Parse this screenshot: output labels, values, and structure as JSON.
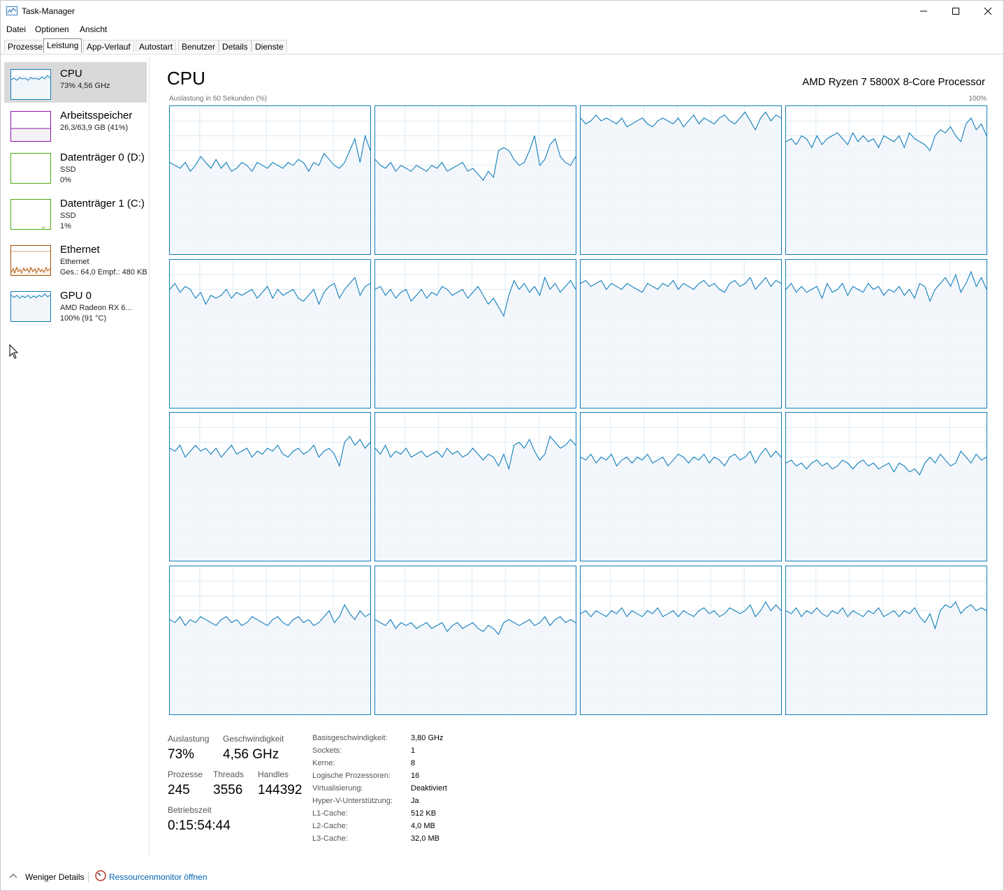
{
  "window": {
    "title": "Task-Manager"
  },
  "menu": [
    "Datei",
    "Optionen",
    "Ansicht"
  ],
  "tabs": [
    "Prozesse",
    "Leistung",
    "App-Verlauf",
    "Autostart",
    "Benutzer",
    "Details",
    "Dienste"
  ],
  "active_tab": "Leistung",
  "sidebar": {
    "items": [
      {
        "title": "CPU",
        "line1": "73% 4,56 GHz",
        "line2": "",
        "color": "#117dbb"
      },
      {
        "title": "Arbeitsspeicher",
        "line1": "26,3/63,9 GB (41%)",
        "line2": "",
        "color": "#8b12ae"
      },
      {
        "title": "Datenträger 0 (D:)",
        "line1": "SSD",
        "line2": "0%",
        "color": "#4da60c"
      },
      {
        "title": "Datenträger 1 (C:)",
        "line1": "SSD",
        "line2": "1%",
        "color": "#4da60c"
      },
      {
        "title": "Ethernet",
        "line1": "Ethernet",
        "line2": "Ges.: 64,0  Empf.: 480 KB",
        "color": "#a74f01"
      },
      {
        "title": "GPU 0",
        "line1": "AMD Radeon RX 6...",
        "line2": "100%  (91 °C)",
        "color": "#117dbb"
      }
    ]
  },
  "main": {
    "title": "CPU",
    "processor": "AMD Ryzen 7 5800X 8-Core Processor",
    "axis_label": "Auslastung in 60 Sekunden (%)",
    "axis_max": "100%"
  },
  "chart_data": {
    "type": "line",
    "description_units": "percent utilization per logical processor over 60 seconds",
    "ylim": [
      0,
      100
    ],
    "x_range_seconds": [
      60,
      0
    ],
    "grid": true,
    "series": [
      {
        "values": [
          62,
          60,
          58,
          62,
          56,
          60,
          66,
          62,
          58,
          64,
          58,
          62,
          56,
          58,
          62,
          60,
          56,
          62,
          60,
          58,
          62,
          60,
          58,
          62,
          60,
          64,
          62,
          56,
          62,
          60,
          68,
          64,
          60,
          58,
          62,
          70,
          78,
          62,
          80,
          70
        ]
      },
      {
        "values": [
          64,
          60,
          58,
          62,
          56,
          60,
          58,
          56,
          60,
          58,
          56,
          60,
          58,
          62,
          56,
          58,
          60,
          62,
          56,
          58,
          54,
          50,
          56,
          52,
          70,
          72,
          70,
          64,
          60,
          62,
          70,
          80,
          60,
          64,
          74,
          78,
          66,
          62,
          60,
          66
        ]
      },
      {
        "values": [
          92,
          88,
          90,
          94,
          90,
          92,
          90,
          88,
          92,
          86,
          88,
          90,
          92,
          88,
          86,
          90,
          92,
          90,
          88,
          92,
          86,
          90,
          94,
          88,
          92,
          90,
          88,
          92,
          94,
          90,
          88,
          92,
          96,
          90,
          84,
          92,
          96,
          90,
          94,
          92
        ]
      },
      {
        "values": [
          76,
          78,
          74,
          80,
          78,
          72,
          80,
          74,
          78,
          80,
          82,
          78,
          74,
          82,
          76,
          80,
          76,
          78,
          72,
          80,
          78,
          76,
          80,
          72,
          82,
          78,
          76,
          74,
          70,
          80,
          84,
          82,
          86,
          80,
          76,
          88,
          92,
          84,
          88,
          80
        ]
      },
      {
        "values": [
          80,
          84,
          78,
          82,
          80,
          74,
          78,
          70,
          76,
          74,
          76,
          80,
          74,
          78,
          76,
          78,
          80,
          74,
          78,
          82,
          74,
          80,
          76,
          78,
          80,
          74,
          72,
          76,
          80,
          70,
          78,
          82,
          84,
          74,
          80,
          84,
          88,
          76,
          82,
          84
        ]
      },
      {
        "values": [
          80,
          82,
          76,
          80,
          74,
          78,
          80,
          72,
          76,
          80,
          74,
          78,
          76,
          82,
          80,
          76,
          78,
          80,
          74,
          78,
          82,
          76,
          70,
          74,
          68,
          62,
          76,
          86,
          80,
          84,
          78,
          82,
          76,
          88,
          80,
          84,
          78,
          82,
          86,
          80
        ]
      },
      {
        "values": [
          84,
          86,
          82,
          84,
          86,
          80,
          84,
          82,
          80,
          84,
          82,
          80,
          78,
          84,
          82,
          80,
          84,
          82,
          86,
          80,
          84,
          82,
          80,
          84,
          86,
          82,
          84,
          80,
          78,
          84,
          86,
          82,
          84,
          88,
          80,
          84,
          88,
          82,
          86,
          84
        ]
      },
      {
        "values": [
          80,
          84,
          78,
          82,
          78,
          80,
          82,
          74,
          84,
          78,
          80,
          84,
          76,
          82,
          80,
          78,
          84,
          80,
          82,
          76,
          80,
          78,
          82,
          76,
          80,
          74,
          84,
          82,
          72,
          80,
          84,
          88,
          82,
          90,
          78,
          84,
          92,
          82,
          88,
          80
        ]
      },
      {
        "values": [
          76,
          74,
          78,
          70,
          74,
          78,
          74,
          76,
          72,
          76,
          70,
          74,
          78,
          72,
          74,
          76,
          70,
          74,
          72,
          76,
          74,
          78,
          72,
          70,
          74,
          76,
          72,
          74,
          78,
          70,
          74,
          76,
          72,
          64,
          80,
          84,
          78,
          82,
          76,
          80
        ]
      },
      {
        "values": [
          76,
          72,
          78,
          70,
          74,
          72,
          76,
          70,
          72,
          74,
          70,
          72,
          74,
          70,
          76,
          72,
          74,
          70,
          72,
          76,
          72,
          68,
          72,
          70,
          64,
          72,
          62,
          78,
          80,
          76,
          82,
          74,
          68,
          72,
          84,
          80,
          76,
          78,
          82,
          78
        ]
      },
      {
        "values": [
          70,
          68,
          72,
          66,
          70,
          68,
          72,
          64,
          68,
          70,
          66,
          70,
          68,
          72,
          66,
          68,
          70,
          64,
          68,
          72,
          70,
          66,
          70,
          68,
          72,
          66,
          70,
          68,
          64,
          70,
          72,
          68,
          70,
          74,
          66,
          72,
          76,
          70,
          74,
          70
        ]
      },
      {
        "values": [
          66,
          68,
          64,
          66,
          62,
          66,
          68,
          64,
          66,
          62,
          64,
          68,
          66,
          62,
          66,
          68,
          64,
          66,
          62,
          64,
          66,
          60,
          66,
          64,
          60,
          62,
          58,
          66,
          70,
          66,
          72,
          68,
          64,
          66,
          74,
          70,
          66,
          72,
          68,
          70
        ]
      },
      {
        "values": [
          64,
          62,
          66,
          60,
          64,
          62,
          66,
          64,
          62,
          60,
          64,
          66,
          62,
          64,
          60,
          62,
          66,
          64,
          62,
          60,
          64,
          66,
          62,
          60,
          64,
          66,
          62,
          64,
          60,
          62,
          66,
          70,
          62,
          66,
          74,
          68,
          64,
          70,
          66,
          68
        ]
      },
      {
        "values": [
          64,
          62,
          60,
          64,
          58,
          62,
          60,
          62,
          58,
          60,
          62,
          58,
          60,
          62,
          56,
          60,
          62,
          58,
          60,
          62,
          58,
          56,
          60,
          58,
          54,
          62,
          64,
          62,
          60,
          62,
          64,
          60,
          62,
          66,
          60,
          64,
          66,
          62,
          64,
          62
        ]
      },
      {
        "values": [
          68,
          70,
          66,
          70,
          68,
          66,
          70,
          68,
          72,
          66,
          70,
          68,
          66,
          70,
          68,
          72,
          66,
          68,
          70,
          66,
          70,
          68,
          66,
          70,
          72,
          68,
          70,
          66,
          68,
          72,
          70,
          68,
          70,
          74,
          66,
          70,
          76,
          70,
          74,
          70
        ]
      },
      {
        "values": [
          70,
          68,
          72,
          66,
          70,
          68,
          72,
          68,
          66,
          70,
          68,
          72,
          66,
          70,
          68,
          66,
          70,
          68,
          72,
          66,
          68,
          70,
          66,
          70,
          68,
          72,
          66,
          62,
          68,
          58,
          70,
          74,
          72,
          76,
          68,
          72,
          74,
          70,
          72,
          70
        ]
      }
    ]
  },
  "stats": {
    "auslastung_label": "Auslastung",
    "auslastung_value": "73%",
    "geschw_label": "Geschwindigkeit",
    "geschw_value": "4,56 GHz",
    "prozesse_label": "Prozesse",
    "prozesse_value": "245",
    "threads_label": "Threads",
    "threads_value": "3556",
    "handles_label": "Handles",
    "handles_value": "144392",
    "uptime_label": "Betriebszeit",
    "uptime_value": "0:15:54:44"
  },
  "details": [
    {
      "key": "Basisgeschwindigkeit:",
      "value": "3,80 GHz"
    },
    {
      "key": "Sockets:",
      "value": "1"
    },
    {
      "key": "Kerne:",
      "value": "8"
    },
    {
      "key": "Logische Prozessoren:",
      "value": "16"
    },
    {
      "key": "Virtualisierung:",
      "value": "Deaktiviert"
    },
    {
      "key": "Hyper-V-Unterstützung:",
      "value": "Ja"
    },
    {
      "key": "L1-Cache:",
      "value": "512 KB"
    },
    {
      "key": "L2-Cache:",
      "value": "4,0 MB"
    },
    {
      "key": "L3-Cache:",
      "value": "32,0 MB"
    }
  ],
  "footer": {
    "less_details": "Weniger Details",
    "resource_monitor": "Ressourcenmonitor öffnen"
  },
  "colors": {
    "cpu_line": "#117dbb",
    "cpu_fill": "#f1f6fa",
    "grid_line": "#d9eaf4"
  }
}
